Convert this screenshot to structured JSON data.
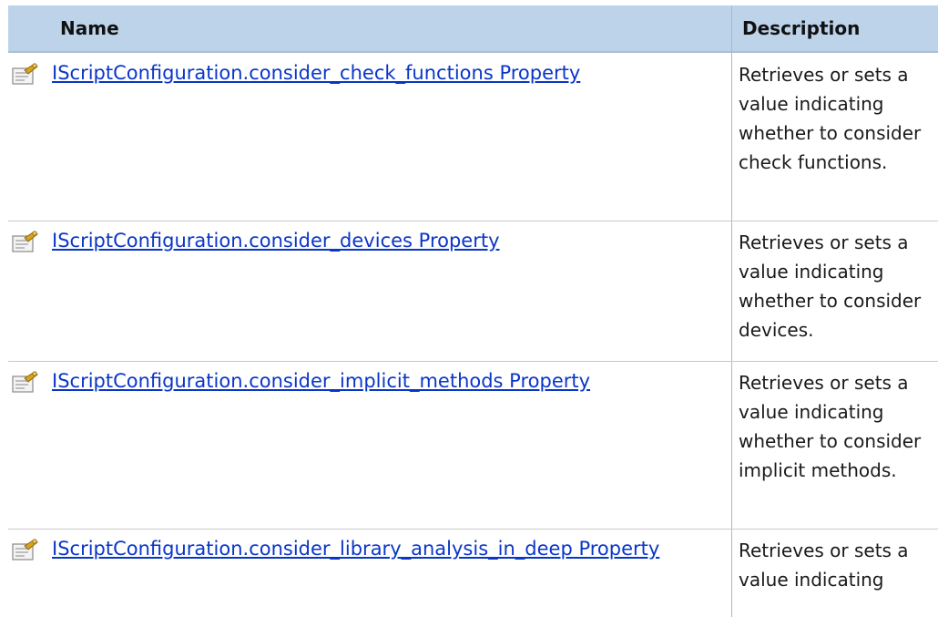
{
  "table": {
    "header": {
      "name": "Name",
      "description": "Description"
    },
    "icon": "property-icon",
    "rows": [
      {
        "name": "IScriptConfiguration.consider_check_functions Property",
        "description": "Retrieves or sets a value indicating whether to consider check functions."
      },
      {
        "name": "IScriptConfiguration.consider_devices Property",
        "description": "Retrieves or sets a value indicating whether to consider devices."
      },
      {
        "name": "IScriptConfiguration.consider_implicit_methods Property",
        "description": "Retrieves or sets a value indicating whether to consider implicit methods."
      },
      {
        "name": "IScriptConfiguration.consider_library_analysis_in_deep Property",
        "description": "Retrieves or sets a value indicating"
      }
    ]
  },
  "colors": {
    "header_bg": "#bdd3ea",
    "link": "#0a36c8"
  }
}
